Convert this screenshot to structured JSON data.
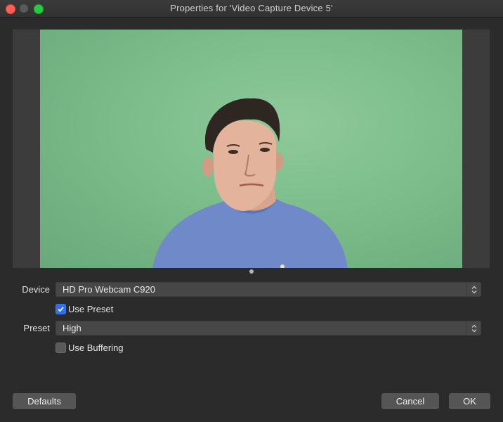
{
  "window": {
    "title": "Properties for 'Video Capture Device 5'"
  },
  "preview": {
    "media_icon": "webcam-preview-person-green-screen"
  },
  "form": {
    "device_label": "Device",
    "device_value": "HD Pro Webcam C920",
    "use_preset_label": "Use Preset",
    "use_preset_checked": true,
    "preset_label": "Preset",
    "preset_value": "High",
    "use_buffering_label": "Use Buffering",
    "use_buffering_checked": false
  },
  "buttons": {
    "defaults": "Defaults",
    "cancel": "Cancel",
    "ok": "OK"
  },
  "colors": {
    "accent": "#2f6fea",
    "close": "#ff5f57",
    "maximize": "#28c840"
  }
}
